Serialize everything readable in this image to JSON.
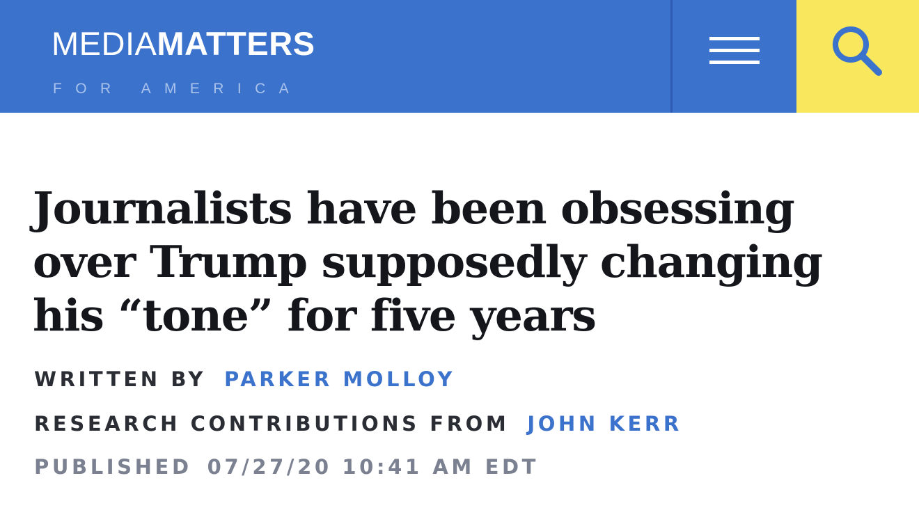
{
  "header": {
    "logo": {
      "light": "MEDIA",
      "bold": "MATTERS",
      "sub": "FOR AMERICA"
    },
    "menu_icon": "hamburger-menu-icon",
    "search_icon": "search-icon",
    "colors": {
      "header_bg": "#3b72cc",
      "search_bg": "#f9e85e",
      "search_icon": "#3b72cc"
    }
  },
  "article": {
    "headline": "Journalists have been obsessing over Trump supposedly changing his “tone” for five years",
    "written_by_label": "WRITTEN BY",
    "author": "PARKER MOLLOY",
    "research_label": "RESEARCH CONTRIBUTIONS FROM",
    "researcher": "JOHN KERR",
    "published_label": "PUBLISHED",
    "published_date": "07/27/20 10:41 AM EDT"
  }
}
